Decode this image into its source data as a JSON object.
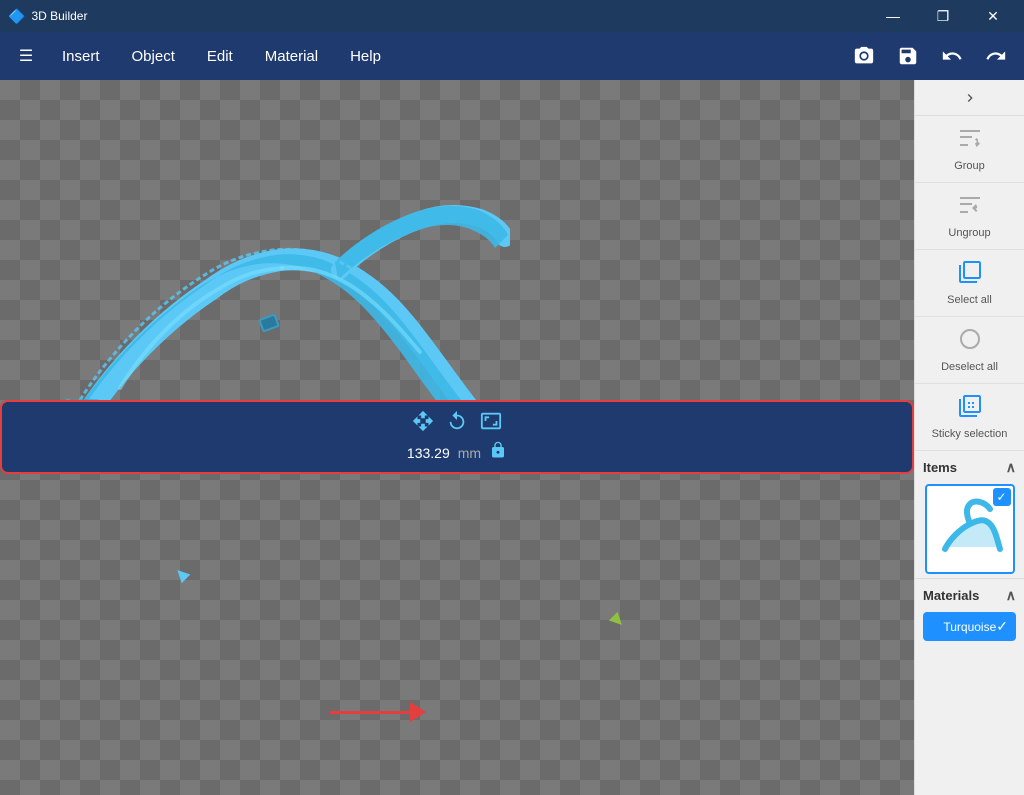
{
  "app": {
    "title": "3D Builder"
  },
  "titlebar": {
    "title": "3D Builder",
    "minimize": "—",
    "restore": "❐",
    "close": "✕"
  },
  "menubar": {
    "hamburger": "☰",
    "items": [
      "Insert",
      "Object",
      "Edit",
      "Material",
      "Help"
    ],
    "icons": [
      "📷",
      "💾",
      "↩",
      "↪"
    ]
  },
  "right_panel": {
    "toggle_icon": "›",
    "group_label": "Group",
    "ungroup_label": "Ungroup",
    "select_all_label": "Select all",
    "deselect_all_label": "Deselect all",
    "sticky_selection_label": "Sticky selection",
    "items_section_label": "Items",
    "materials_section_label": "Materials",
    "material_name": "Turquoise",
    "collapse_icon": "∧"
  },
  "bottom_toolbar": {
    "measurement_value": "133.29",
    "measurement_unit": "mm",
    "icon_move": "⊞",
    "icon_rotate": "↺",
    "icon_scale": "⤡",
    "icon_lock": "🔓"
  },
  "colors": {
    "titlebar_bg": "#1e3a5f",
    "menubar_bg": "#1e3a6e",
    "panel_bg": "#f0f0f0",
    "accent_blue": "#1e90ff",
    "object_blue": "#3db8e8",
    "red_border": "#e53e3e"
  }
}
